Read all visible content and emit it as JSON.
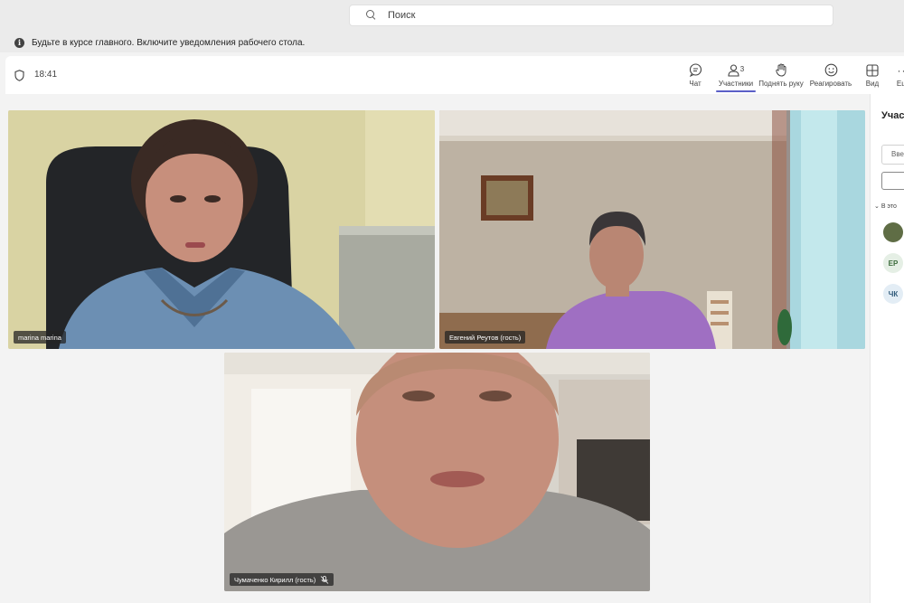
{
  "search": {
    "placeholder": "Поиск"
  },
  "notification": {
    "text": "Будьте в курсе главного. Включите уведомления рабочего стола."
  },
  "meeting": {
    "time": "18:41"
  },
  "toolbar": {
    "chat": "Чат",
    "participants": "Участники",
    "participants_count": "3",
    "raise_hand": "Поднять руку",
    "react": "Реагировать",
    "view": "Вид",
    "more": "Еще"
  },
  "tiles": [
    {
      "name": "marina marina"
    },
    {
      "name": "Евгений Реутов (гость)"
    },
    {
      "name": "Чумаченко Кирилл (гость)"
    }
  ],
  "panel": {
    "title": "Участ",
    "input_placeholder": "Вве",
    "section_label": "В это",
    "avatars": [
      "",
      "ЕР",
      "ЧК"
    ]
  },
  "colors": {
    "accent": "#5b5fc7"
  }
}
